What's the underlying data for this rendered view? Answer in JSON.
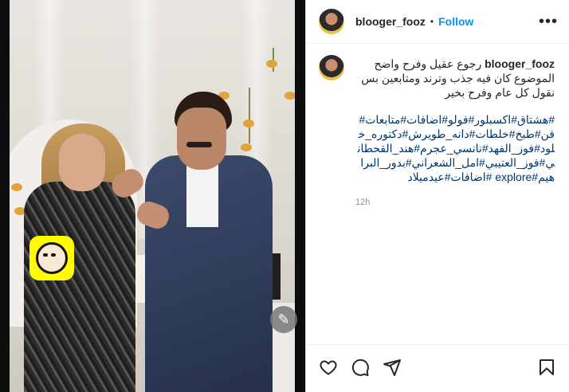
{
  "post": {
    "username": "blooger_fooz",
    "separator": "•",
    "follow_label": "Follow",
    "more_label": "•••",
    "caption_username": "blooger_fooz",
    "caption_text": "رجوع عقيل وفرح واضح الموضوع كان فيه جذب وترند ومتابعين بس نقول كل عام وفرح بخير",
    "hashtags": "#هشتاق#اكسبلور#فولو#اضافات#متابعات#فن#طبخ#خلطات#دانه_طويرش#دكتوره_خلود#فوز_الفهد#نانسي_عجرم#هند_القحطاني#فوز_العتيبي#امل_الشعراني#بدور_البراهيم#explore #اضافات#عيدميلاد",
    "timestamp": "12h"
  },
  "icons": {
    "like": "heart-icon",
    "comment": "comment-icon",
    "share": "share-icon",
    "save": "bookmark-icon",
    "edit": "pencil-icon"
  },
  "colors": {
    "follow": "#0095f6",
    "hashtag": "#00376b",
    "timestamp": "#8e8e8e",
    "snapcode": "#fffc00"
  }
}
